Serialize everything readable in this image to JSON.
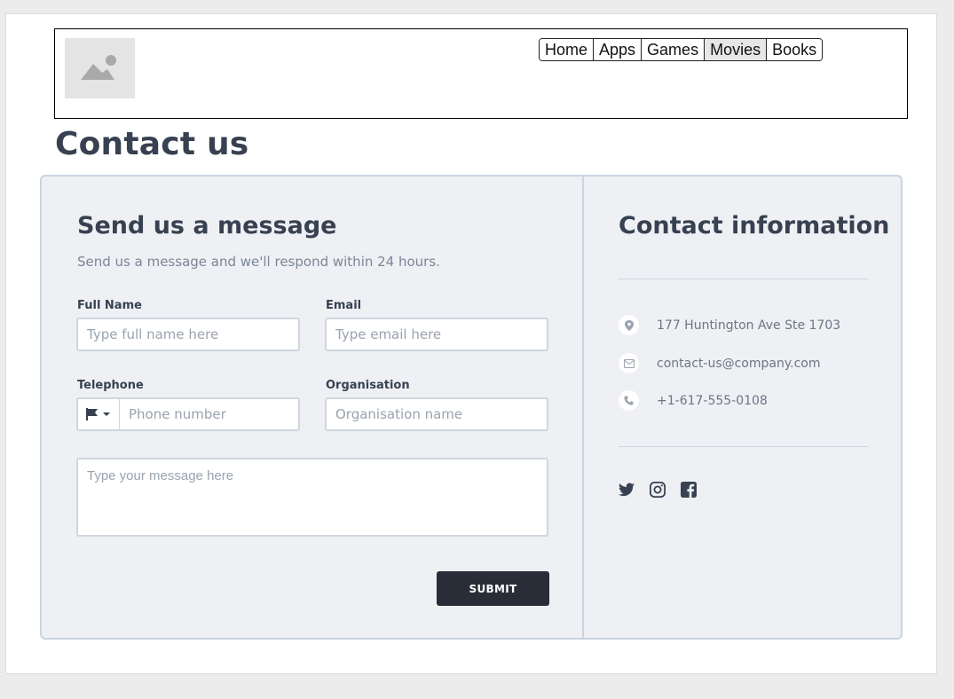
{
  "nav": {
    "items": [
      {
        "label": "Home",
        "active": false
      },
      {
        "label": "Apps",
        "active": false
      },
      {
        "label": "Games",
        "active": false
      },
      {
        "label": "Movies",
        "active": true
      },
      {
        "label": "Books",
        "active": false
      }
    ]
  },
  "page_title": "Contact us",
  "form": {
    "title": "Send us a message",
    "subtitle": "Send us a message and we'll respond within 24 hours.",
    "full_name": {
      "label": "Full Name",
      "placeholder": "Type full name here"
    },
    "email": {
      "label": "Email",
      "placeholder": "Type email here"
    },
    "telephone": {
      "label": "Telephone",
      "placeholder": "Phone number"
    },
    "organisation": {
      "label": "Organisation",
      "placeholder": "Organisation name"
    },
    "message": {
      "placeholder": "Type your message here"
    },
    "submit_label": "SUBMIT"
  },
  "contact": {
    "title": "Contact information",
    "address": "177 Huntington Ave Ste 1703",
    "email": "contact-us@company.com",
    "phone": "+1-617-555-0108",
    "socials": [
      "twitter-icon",
      "instagram-icon",
      "facebook-icon"
    ]
  },
  "colors": {
    "heading": "#374151",
    "submit_bg": "#282d38",
    "card_bg": "#eef0f3",
    "card_border": "#cbd5e1"
  }
}
